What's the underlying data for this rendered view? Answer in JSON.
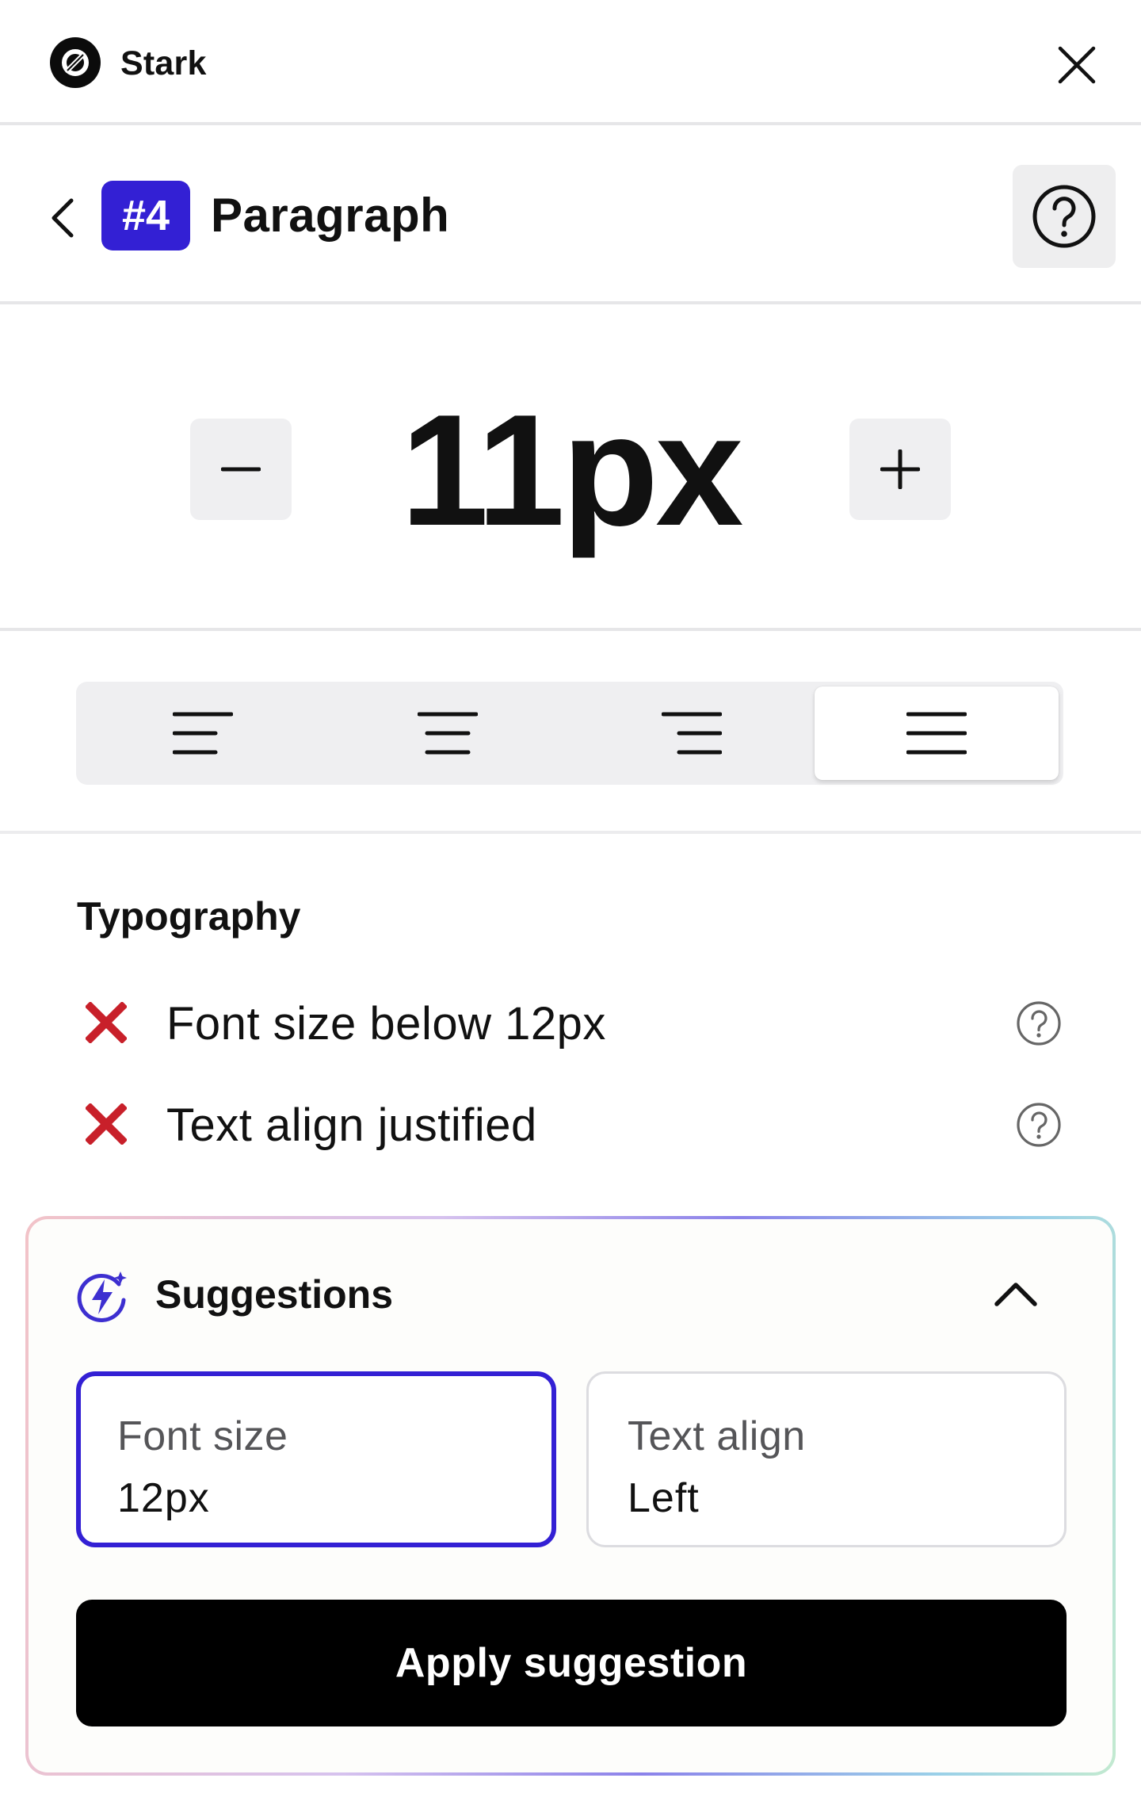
{
  "app": {
    "title": "Stark",
    "logo_icon": "stark-logo-icon",
    "close_icon": "close-icon"
  },
  "element": {
    "badge": "#4",
    "title": "Paragraph",
    "back_icon": "chevron-left-icon",
    "help_icon": "help-circle-icon",
    "accent_color": "#3320d4"
  },
  "font_size": {
    "value": "11px",
    "decrease_icon": "minus-icon",
    "increase_icon": "plus-icon"
  },
  "alignment": {
    "options": [
      {
        "id": "left",
        "icon": "align-left-icon"
      },
      {
        "id": "center",
        "icon": "align-center-icon"
      },
      {
        "id": "right",
        "icon": "align-right-icon"
      },
      {
        "id": "justify",
        "icon": "align-justify-icon"
      }
    ],
    "selected": "justify"
  },
  "typography": {
    "heading": "Typography",
    "issues": [
      {
        "text": "Font size below 12px",
        "status_icon": "x-mark-icon",
        "status_color": "#c8202a"
      },
      {
        "text": "Text align justified",
        "status_icon": "x-mark-icon",
        "status_color": "#c8202a"
      }
    ]
  },
  "suggestions": {
    "title": "Suggestions",
    "icon": "ai-bolt-icon",
    "collapse_icon": "chevron-up-icon",
    "options": [
      {
        "label": "Font size",
        "value": "12px",
        "selected": true
      },
      {
        "label": "Text align",
        "value": "Left",
        "selected": false
      }
    ],
    "apply_label": "Apply suggestion"
  }
}
